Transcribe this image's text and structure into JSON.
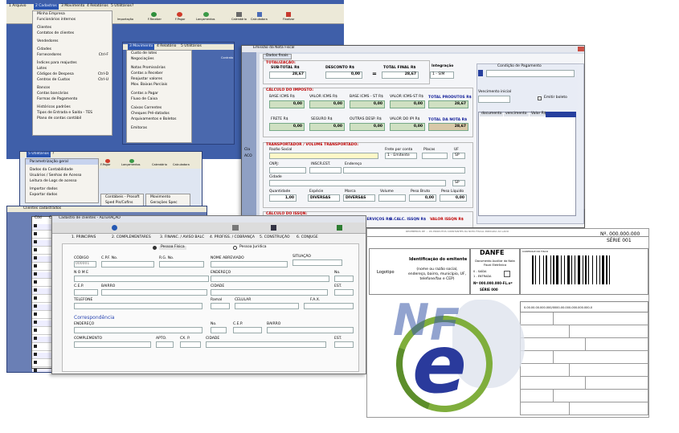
{
  "back_window": {
    "menubar": [
      "1 Arquivo",
      "2 Cadastros",
      "3 Movimento",
      "4 Relatórios",
      "5 Utilitários",
      "?"
    ],
    "cadastros_menu": [
      "Minha Empresa",
      "Funcionários internos",
      "Clientes",
      "Contatos de clientes",
      "Vendedores",
      "Cidades",
      "Fornecedores",
      "Índices para reajustes",
      "Lotes",
      "Códigos de Despesa",
      "Centros de Custos",
      "Bancos",
      "Contas bancárias",
      "Formas de Pagamento",
      "Históricos padrões",
      "Tipos de Entrada e Saída - TES",
      "Plano de contas contábil"
    ],
    "menu_shortcuts": [
      "Ctrl-F",
      "Ctrl-D",
      "Ctrl-U"
    ],
    "toolbar": [
      "Importação",
      "F.Receber",
      "F.Pagar",
      "Lançamentos",
      "Calendário",
      "Calculadora",
      "Finalizar"
    ]
  },
  "movimento_window": {
    "menubar": [
      "3 Movimento",
      "4 Relatório",
      "5 Utilitários"
    ],
    "items": [
      "Custo de lotes",
      "Negociações",
      "Notas Promissórias",
      "Contas a Receber",
      "Reajustar valores",
      "Mov. Baixas Parciais",
      "Contas a Pagar",
      "Fluxo de Caixa",
      "Caixas Correntes",
      "Cheques Pré-datados",
      "Arquivamentos e Boletos",
      "Emitoras"
    ],
    "toolbar": [
      "Contrato"
    ]
  },
  "util_window": {
    "menubar": [
      "5 Utilitários",
      "?"
    ],
    "items": [
      "Parametrização geral",
      "Dados da Contabilidade",
      "Usuários / Senhas de Acesso",
      "Leitura de Logs de acesso",
      "Importar dados",
      "Exportar dados"
    ],
    "submenu": [
      "Contábeis - Prosoft",
      "Sped Pis/Cofins"
    ],
    "submenu2": [
      "Movimento",
      "Gerações Spec"
    ],
    "toolbar": [
      "F.Pagar",
      "Lançamentos",
      "Calendário",
      "Calculadora"
    ]
  },
  "nota_window": {
    "title": "Emissão da Nota Fiscal",
    "tab": "Dados finais",
    "totalizacao": {
      "label": "TOTALIZAÇÃO:",
      "sub_total_label": "SUB-TOTAL R$",
      "sub_total": "28,67",
      "desconto_label": "DESCONTO R$",
      "desconto": "0,00",
      "total_final_label": "TOTAL FINAL R$",
      "total_final": "28,67"
    },
    "integracao_label": "Integração",
    "integracao_value": "1 - SIM",
    "calculo_imposto": {
      "label": "CÁLCULO DO IMPOSTO:",
      "base_icms": "BASE ICMS R$",
      "valor_icms": "VALOR ICMS R$",
      "base_icms_st": "BASE ICMS - ST R$",
      "valor_icms_st": "VALOR ICMS-ST R$",
      "total_produtos_label": "TOTAL PRODUTOS R$",
      "total_produtos": "28,67",
      "frete": "FRETE R$",
      "seguro": "SEGURO R$",
      "outras": "OUTRAS DESP. R$",
      "ipi": "VALOR DO IPI R$",
      "total_nota_label": "TOTAL DA NOTA R$",
      "total_nota": "28,67",
      "zeros": [
        "0,00",
        "0,00",
        "0,00",
        "0,00",
        "0,00",
        "0,00",
        "0,00",
        "0,00"
      ]
    },
    "condicao_pagamento": "Condição de Pagamento",
    "vencimento_inicial": "Vencimento inicial",
    "emitir_boleto": "Emitir boleto",
    "parcel_cols": [
      "documento",
      "vencimento",
      "Valor R$"
    ],
    "transp": {
      "label": "TRANSPORTADOR / VOLUME TRANSPORTADO:",
      "razao": "Razão Social",
      "frete_conta": "Frete por conta",
      "frete_value": "1 - Emitente",
      "placas": "Placas",
      "uf": "UF",
      "uf_value": "SP",
      "cnpj": "CNPJ:",
      "insc": "INSCR.EST.",
      "endereco": "Endereço",
      "cidade": "Cidade",
      "uf2_value": "SP",
      "quantidade": "Quantidade",
      "quantidade_value": "1,00",
      "especie": "Espécie",
      "especie_value": "DIVERSAS",
      "marca": "Marca",
      "marca_value": "DIVERSAS",
      "volume": "Volume",
      "peso_bruto": "Peso Bruto",
      "peso_bruto_value": "0,00",
      "peso_liquido": "Peso Líquido",
      "peso_liquido_value": "0,00"
    },
    "issqn": {
      "label": "CÁLCULO DO ISSQN:",
      "insc_mun": "Insc.Municipal",
      "valor_servicos": "VALOR SERVIÇOS R$",
      "bcalc": "B.CALC. ISSQN R$",
      "valor_issqn": "VALOR ISSQN R$"
    },
    "side_labels": [
      "Cla",
      "ACO"
    ]
  },
  "clientes_window": {
    "small_title": "Clientes cadastrados",
    "title": "Cadastro de clientes - ALTERAÇÃO",
    "left_col": [
      "Cód",
      "Cli"
    ],
    "tabs": [
      "1. PRINCIPAIS",
      "2. COMPLEMENTARES",
      "3. FINANC. / AVISO BALC",
      "4. PROFISS. / COBRANÇA",
      "5. CONSTRUÇÃO",
      "6. CONJUGE"
    ],
    "radio_fisica": "Pessoa Física",
    "radio_juridica": "Pessoa Jurídica",
    "labels": {
      "codigo": "CÓDIGO",
      "cpf": "C.P.F. No.",
      "rg": "R.G. No.",
      "nome_abreviado": "NOME ABREVIADO",
      "situacao": "SITUAÇÃO",
      "nome": "N O M E",
      "endereco": "ENDEREÇO",
      "no": "No.",
      "cep": "C.E.P.",
      "bairro": "BAIRRO",
      "cidade": "CIDADE",
      "est": "EST.",
      "telefone": "TELEFONE",
      "ramal": "Ramal",
      "celular": "CELULAR",
      "fax": "F.A.X.",
      "correspondencia": "Correspondência",
      "endereco2": "ENDEREÇO",
      "no2": "No.",
      "cep2": "C.E.P.",
      "bairro2": "BAIRRO",
      "complemento": "COMPLEMENTO",
      "apto": "APTO.",
      "cx_p": "CX. P.",
      "cidade2": "CIDADE",
      "est2": "EST."
    },
    "codigo_value": "000001"
  },
  "danfe": {
    "title": "DANFE",
    "subtitle": "Documento Auxiliar da Nota Fiscal Eletrônica",
    "entrada_saida": [
      "0 - SAÍDA",
      "1 - ENTRADA"
    ],
    "numero": "Nº 000.000.000-FL.nº",
    "serie_small": "SÉRIE 000",
    "logo": "Logotipo",
    "identificacao": "Identificação do emitente",
    "emitente_desc": "(nome ou razão social, endereço, bairro, município, UF, telefone/fax e CEP)",
    "nf_number": "Nº. 000.000.000",
    "serie": "SÉRIE 001",
    "chave": "0.00.00.00.000.000/0000-00.000-000.000.000-0",
    "controle": "CONTROLE DO FISCO",
    "recebemos": "RECEBEMOS DE ... OS PRODUTOS CONSTANTES DA NOTA FISCAL INDICADA AO LADO",
    "logo_letters": [
      "N",
      "F",
      "e"
    ],
    "colors": {
      "navy": "#2a3a9c",
      "blue": "#3a58a8",
      "green": "#7fae3c"
    }
  }
}
